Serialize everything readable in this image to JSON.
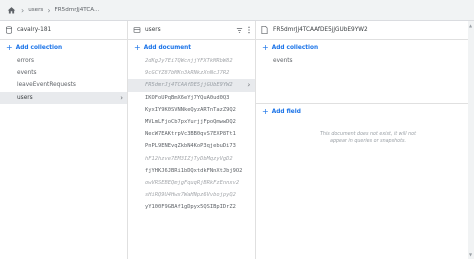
{
  "breadcrumb": {
    "root": "users",
    "current": "FR5dmrJj4TCA..."
  },
  "left_panel": {
    "title": "cavalry-181",
    "add_label": "Add collection",
    "items": [
      {
        "label": "errors"
      },
      {
        "label": "events"
      },
      {
        "label": "leaveEventRequests"
      },
      {
        "label": "users"
      }
    ]
  },
  "middle_panel": {
    "title": "users",
    "add_label": "Add document",
    "docs": [
      {
        "id": "2dKgJy7Ei7QWcnjjYFXTkMRbW82",
        "faded": true
      },
      {
        "id": "9cGCYZ87bMKn3kRNkzXnNcJ7R2",
        "faded": true
      },
      {
        "id": "FR5dmrJj4TCAAfDE5jjGUbE9YW2",
        "faded": true
      },
      {
        "id": "IKOFoUPqBmX6eYj7YQuA0ud0Q3",
        "faded": false
      },
      {
        "id": "KyxIY9K0SVNNkeQyzARTnTazZ9Q2",
        "faded": false
      },
      {
        "id": "MVLmLFjoCb7pxYurjjFpoQmwwDQ2",
        "faded": false
      },
      {
        "id": "NecW7EAKtrpVc3BB0qvS7EXP8Tt1",
        "faded": false
      },
      {
        "id": "PnPL9ENEvqZkbN4KoP3qjebuDi73",
        "faded": false
      },
      {
        "id": "hF12hzve7EM3IZjTyDbMqzyVgD2",
        "faded": true
      },
      {
        "id": "fjYHKJ6JBRi1bDQxtdkFNnXtJbj9O2",
        "faded": false
      },
      {
        "id": "owVRSEBEQmjgFquqRjBRkFzEnnxv2",
        "faded": true
      },
      {
        "id": "sHiRQ9U4Hwx7WaHNpz6VvbojpyQ2",
        "faded": true
      },
      {
        "id": "yY100F9GBAf1gDpyx5QSIBpIDrZ2",
        "faded": false
      }
    ],
    "active_index": 2
  },
  "right_panel": {
    "title": "FR5dmrJj4TCAAfDE5jjGUbE9YW2",
    "add_collection_label": "Add collection",
    "subcollections": [
      "events"
    ],
    "add_field_label": "Add field",
    "empty_note": "This document does not exist, it will not appear in queries or snapshots."
  }
}
